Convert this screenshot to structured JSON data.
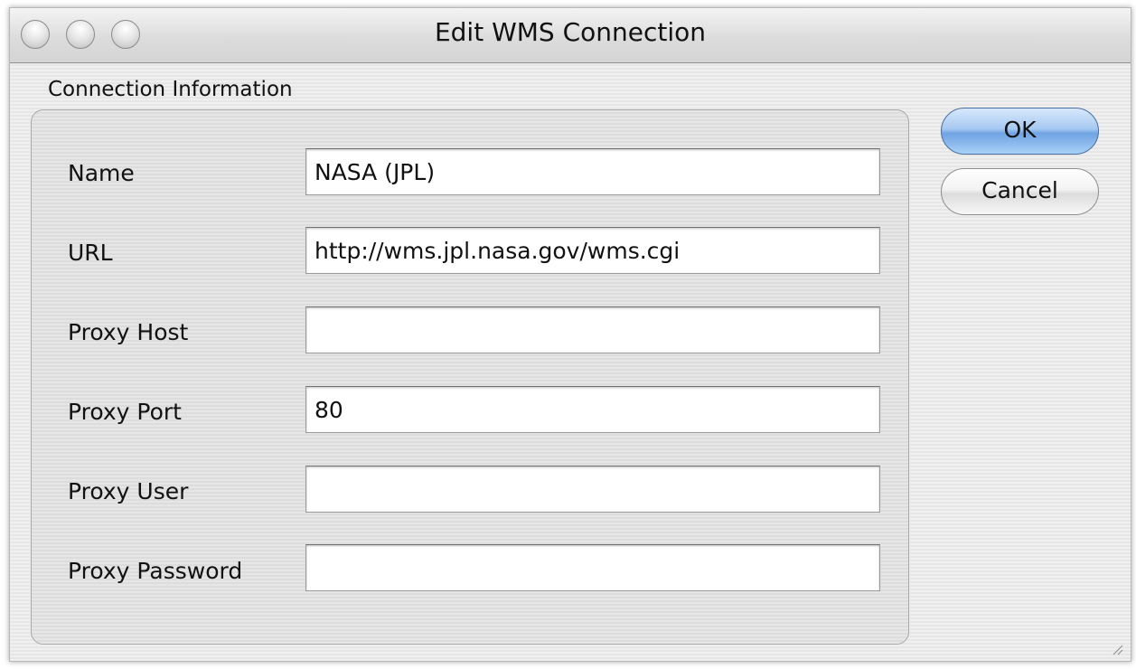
{
  "window": {
    "title": "Edit WMS Connection"
  },
  "group": {
    "label": "Connection Information"
  },
  "fields": {
    "name": {
      "label": "Name",
      "value": "NASA (JPL)"
    },
    "url": {
      "label": "URL",
      "value": "http://wms.jpl.nasa.gov/wms.cgi"
    },
    "proxy_host": {
      "label": "Proxy Host",
      "value": ""
    },
    "proxy_port": {
      "label": "Proxy Port",
      "value": "80"
    },
    "proxy_user": {
      "label": "Proxy User",
      "value": ""
    },
    "proxy_password": {
      "label": "Proxy Password",
      "value": ""
    }
  },
  "buttons": {
    "ok_label": "OK",
    "cancel_label": "Cancel"
  },
  "icons": {
    "close": "close-button",
    "minimize": "minimize-button",
    "zoom": "zoom-button",
    "resize": "resize-grip-icon"
  },
  "colors": {
    "default_button": "#8fb8ec",
    "window_background": "#ececec"
  }
}
